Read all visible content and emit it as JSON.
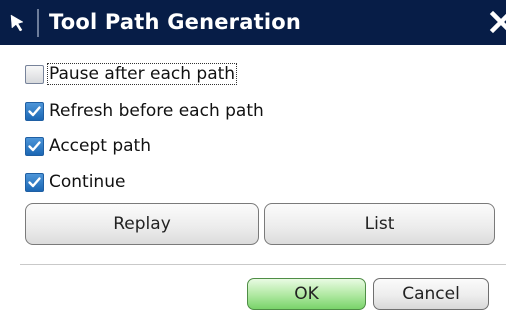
{
  "dialog": {
    "title": "Tool Path Generation"
  },
  "options": [
    {
      "label": "Pause after each path",
      "checked": false
    },
    {
      "label": "Refresh before each path",
      "checked": true
    },
    {
      "label": "Accept path",
      "checked": true
    },
    {
      "label": "Continue",
      "checked": true
    }
  ],
  "buttons": {
    "replay": "Replay",
    "list": "List",
    "ok": "OK",
    "cancel": "Cancel"
  },
  "icons": {
    "title_cursor": "arrow-cursor-icon",
    "close": "close-icon",
    "check": "check-icon"
  },
  "colors": {
    "titlebar": "#071d47",
    "checkbox_checked": "#1b67b4",
    "ok_button": "#79d36a"
  }
}
